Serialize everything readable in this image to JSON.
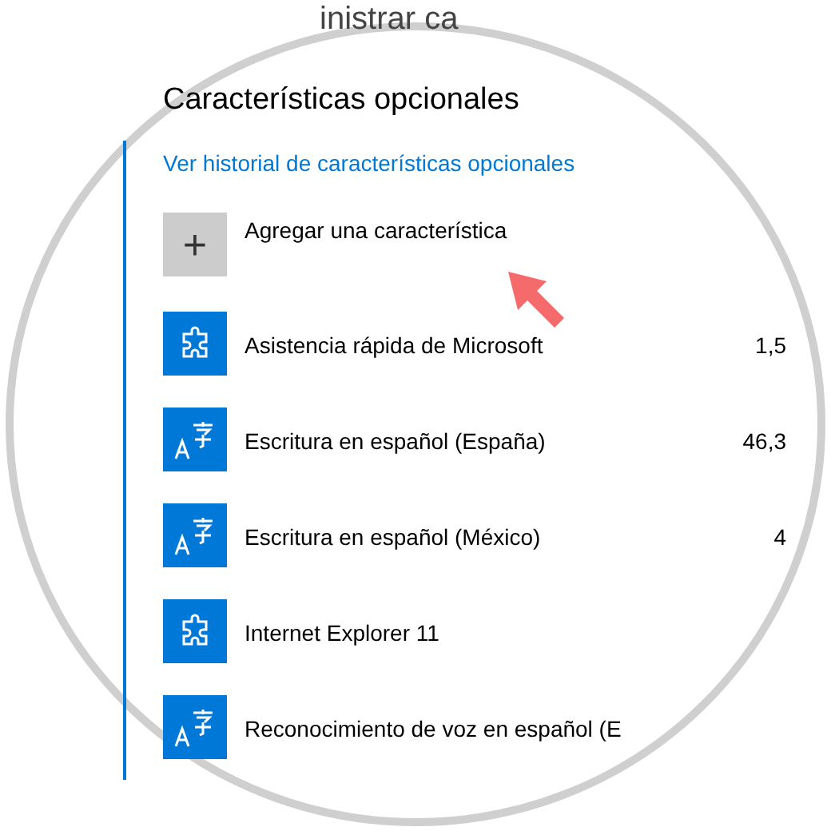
{
  "page_title": "inistrar ca",
  "section_title": "Características opcionales",
  "history_link": "Ver historial de características opcionales",
  "add_button": {
    "icon": "+",
    "label": "Agregar una característica"
  },
  "features": [
    {
      "kind": "puzzle",
      "name": "Asistencia rápida de Microsoft",
      "size": "1,5"
    },
    {
      "kind": "language",
      "name": "Escritura en español (España)",
      "size": "46,3"
    },
    {
      "kind": "language",
      "name": "Escritura en español (México)",
      "size": "4"
    },
    {
      "kind": "puzzle",
      "name": "Internet Explorer 11"
    },
    {
      "kind": "language",
      "name": "Reconocimiento de voz en español (E"
    }
  ]
}
